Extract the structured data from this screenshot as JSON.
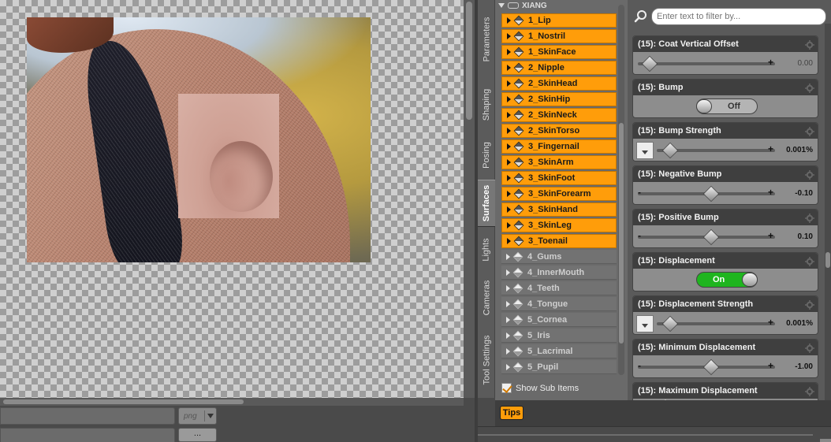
{
  "viewport": {
    "format_value": "png",
    "browse_label": "..."
  },
  "side_tabs": [
    "Parameters",
    "Shaping",
    "Posing",
    "Surfaces",
    "Lights",
    "Cameras",
    "Tool Settings"
  ],
  "active_tab": "Surfaces",
  "tree": {
    "figure_name": "XIANG",
    "selected_items": [
      "1_Lip",
      "1_Nostril",
      "1_SkinFace",
      "2_Nipple",
      "2_SkinHead",
      "2_SkinHip",
      "2_SkinNeck",
      "2_SkinTorso",
      "3_Fingernail",
      "3_SkinArm",
      "3_SkinFoot",
      "3_SkinForearm",
      "3_SkinHand",
      "3_SkinLeg",
      "3_Toenail"
    ],
    "unselected_items": [
      "4_Gums",
      "4_InnerMouth",
      "4_Teeth",
      "4_Tongue",
      "5_Cornea",
      "5_Iris",
      "5_Lacrimal",
      "5_Pupil"
    ],
    "show_sub_items_label": "Show Sub Items",
    "show_sub_items_checked": true
  },
  "filter": {
    "placeholder": "Enter text to filter by..."
  },
  "properties": [
    {
      "title": "(15): Coat Vertical Offset",
      "control": "slider",
      "left_symbol": "",
      "value": "0.00",
      "knob_fraction": 0.03,
      "dim": true
    },
    {
      "title": "(15): Bump",
      "control": "toggle",
      "state": "Off"
    },
    {
      "title": "(15): Bump Strength",
      "control": "map-slider",
      "value": "0.001%",
      "knob_fraction": 0.05
    },
    {
      "title": "(15): Negative Bump",
      "control": "slider",
      "left_symbol": "-",
      "value": "-0.10",
      "knob_fraction": 0.5
    },
    {
      "title": "(15): Positive Bump",
      "control": "slider",
      "left_symbol": "-",
      "value": "0.10",
      "knob_fraction": 0.5
    },
    {
      "title": "(15): Displacement",
      "control": "toggle",
      "state": "On"
    },
    {
      "title": "(15): Displacement Strength",
      "control": "map-slider",
      "value": "0.001%",
      "knob_fraction": 0.05
    },
    {
      "title": "(15): Minimum Displacement",
      "control": "slider",
      "left_symbol": "-",
      "value": "-1.00",
      "knob_fraction": 0.5
    },
    {
      "title": "(15): Maximum Displacement",
      "control": "header-only"
    }
  ],
  "tips_label": "Tips",
  "colors": {
    "selected_item": "#ff9d0a",
    "toggle_on": "#1fb51f",
    "panel_header": "#3f3f3f"
  }
}
